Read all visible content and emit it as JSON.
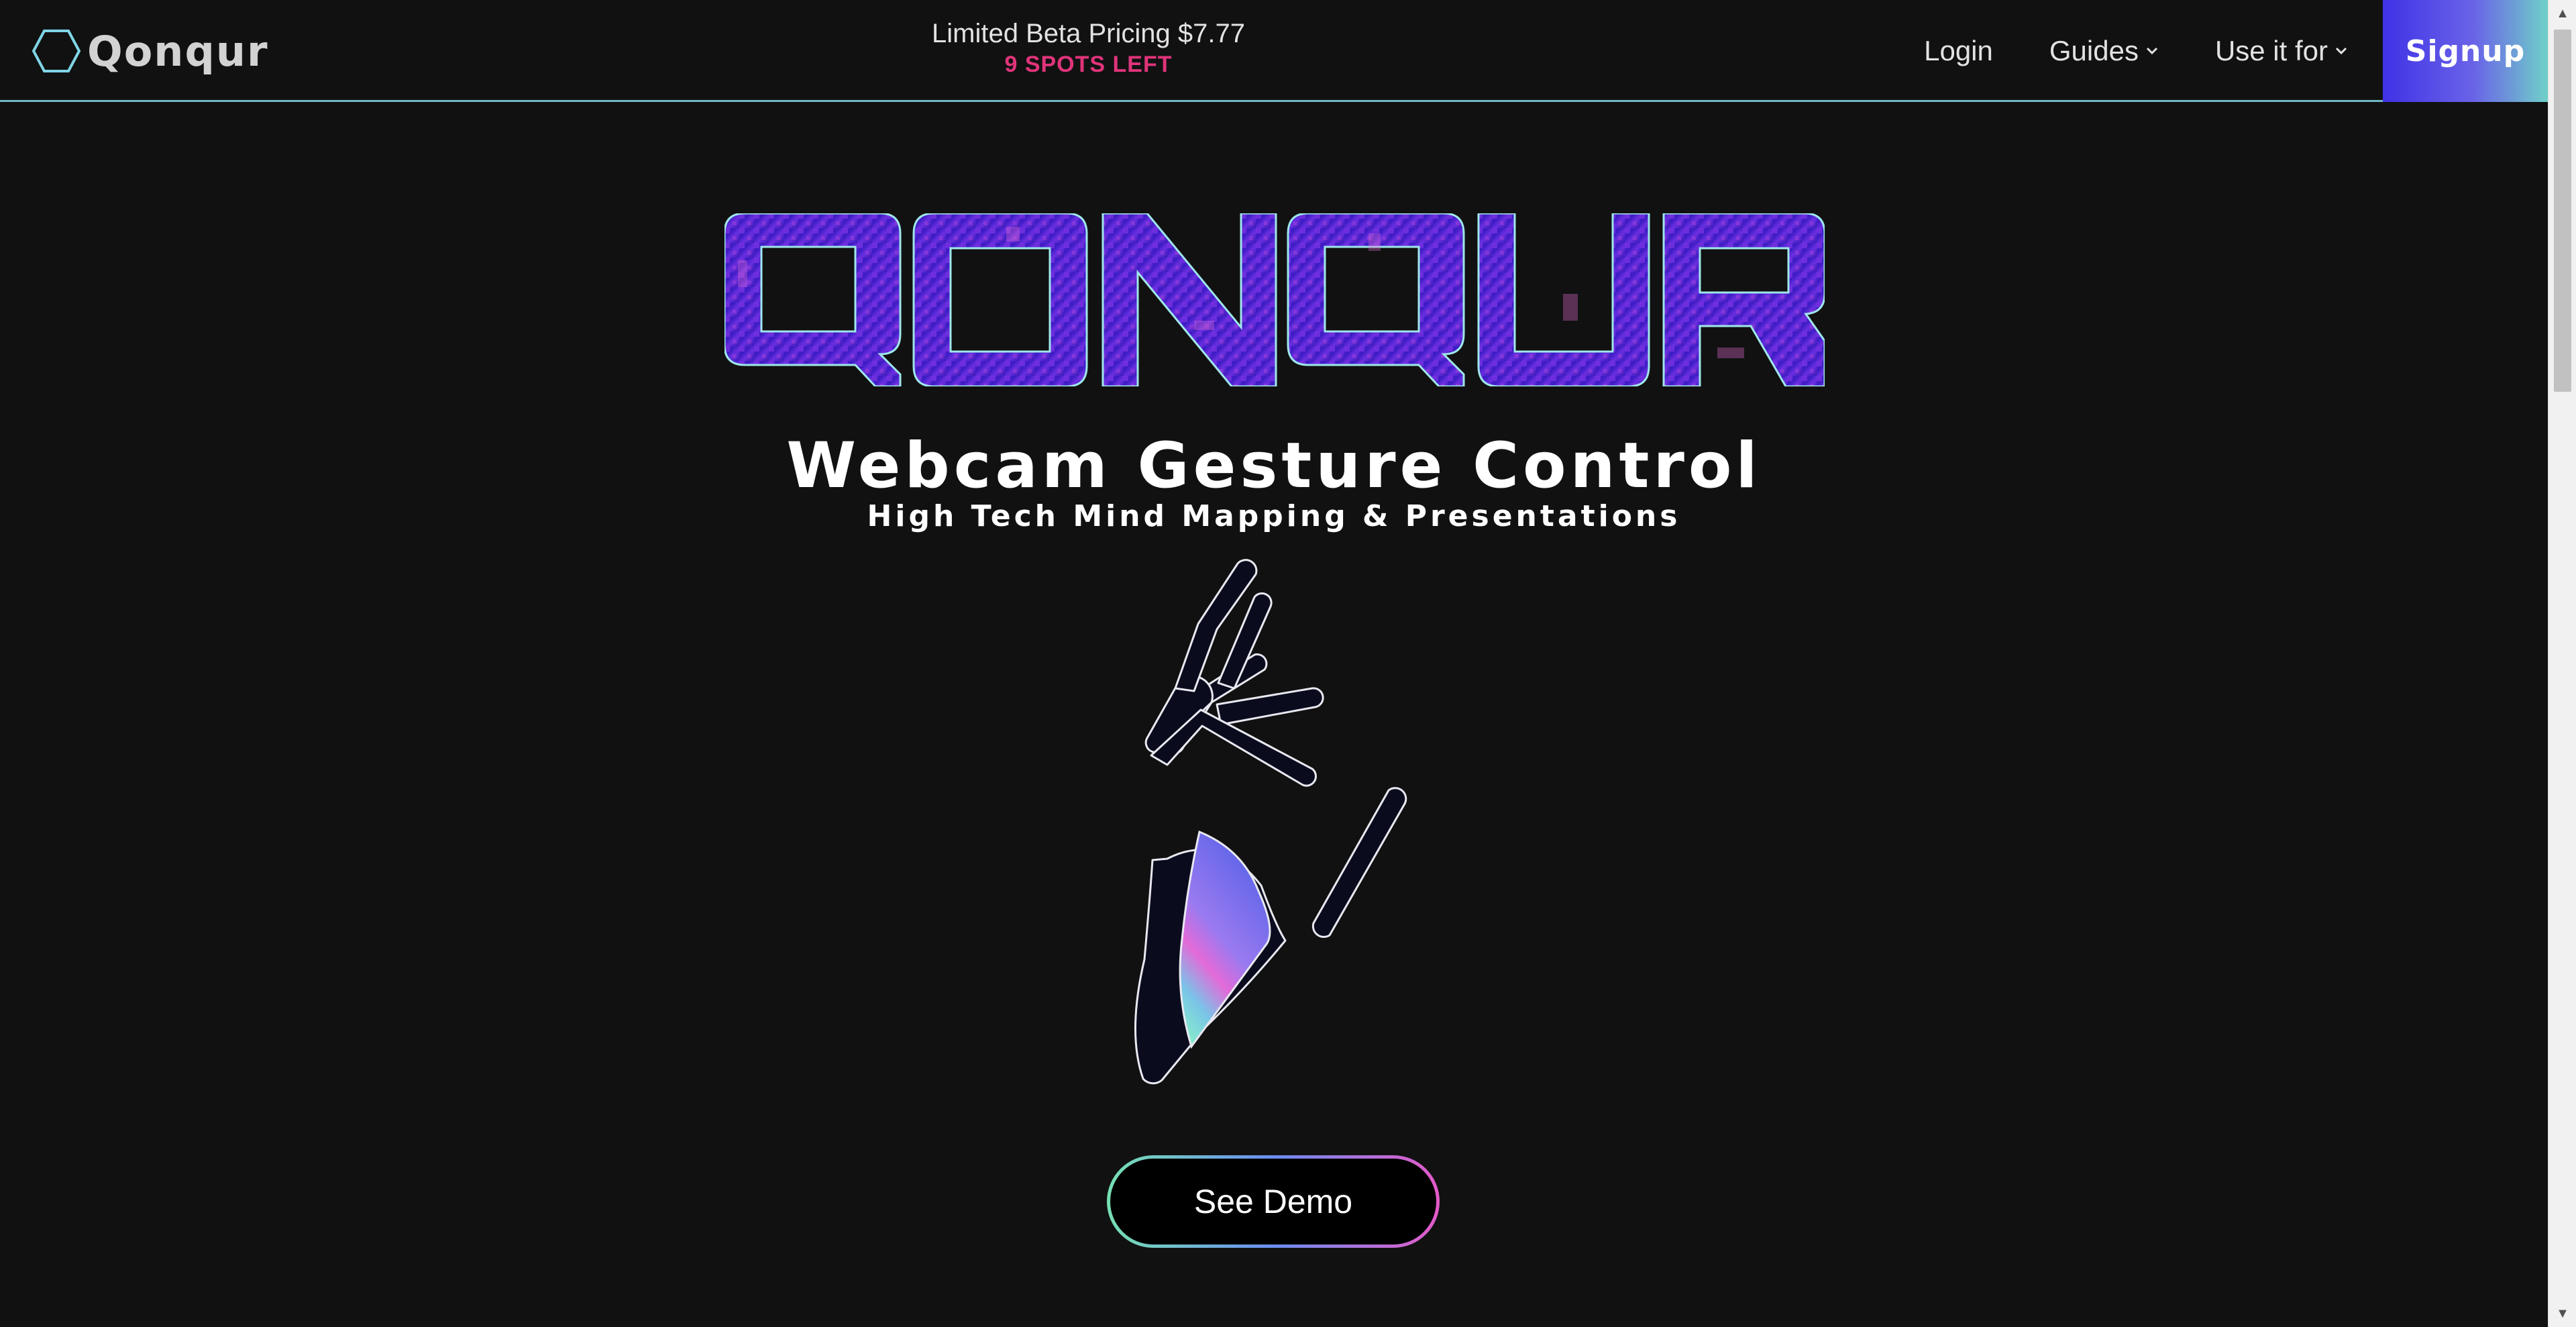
{
  "nav": {
    "brand": "Qonqur",
    "promo_price": "Limited Beta Pricing $7.77",
    "promo_spots": "9 SPOTS LEFT",
    "links": [
      {
        "label": "Login",
        "has_dropdown": false
      },
      {
        "label": "Guides",
        "has_dropdown": true
      },
      {
        "label": "Use it for",
        "has_dropdown": true
      }
    ],
    "signup_label": "Signup"
  },
  "hero": {
    "logo_text": "QONQUR",
    "headline": "Webcam Gesture Control",
    "subheadline": "High Tech Mind Mapping & Presentations",
    "cta_label": "See Demo"
  },
  "colors": {
    "background": "#111112",
    "nav_border": "#6fb9c4",
    "spots_accent": "#e0347a",
    "signup_gradient": [
      "#3f32e6",
      "#6fd0c8"
    ],
    "logo_fill": "#4a1fd0",
    "logo_outline": "#9fe7ea"
  },
  "icons": {
    "brand": "hexagon-logo-icon",
    "dropdown": "chevron-down-icon",
    "hero": "hand-gesture-icon"
  }
}
